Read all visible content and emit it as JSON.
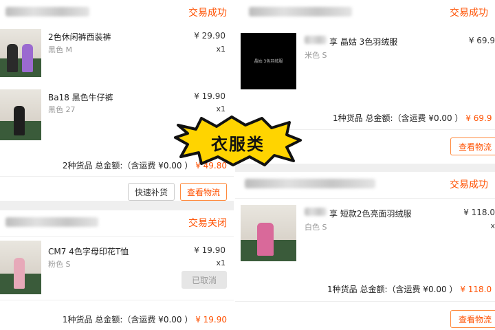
{
  "badge_text": "衣服类",
  "left": {
    "order1": {
      "status": "交易成功",
      "items": [
        {
          "title": "2色休闲裤西装裤",
          "sku": "黑色 M",
          "price": "¥ 29.90",
          "qty": "x1"
        },
        {
          "title": "Ba18 黑色牛仔裤",
          "sku": "黑色 27",
          "price": "¥ 19.90",
          "qty": "x1"
        }
      ],
      "summary": "2种货品 总金额:（含运费 ¥0.00 ）",
      "total": "¥ 49.80",
      "buttons": {
        "restock": "快速补货",
        "logistics": "查看物流"
      }
    },
    "order2": {
      "status": "交易关闭",
      "item": {
        "title": "CM7 4色字母印花T恤",
        "sku": "粉色 S",
        "price": "¥ 19.90",
        "qty": "x1"
      },
      "cancelled": "已取消",
      "summary": "1种货品 总金额:（含运费 ¥0.00 ）",
      "total": "¥ 19.90"
    }
  },
  "right": {
    "order1": {
      "status": "交易成功",
      "item": {
        "title": "享 晶姑 3色羽绒服",
        "thumb_text": "晶姑 3色羽绒服",
        "sku": "米色 S",
        "price": "¥ 69.9"
      },
      "summary": "1种货品 总金额:（含运费 ¥0.00 ）",
      "total": "¥ 69.9",
      "button": "查看物流"
    },
    "order2": {
      "status": "交易成功",
      "item": {
        "title": "享 短款2色亮面羽绒服",
        "sku": "白色 S",
        "price": "¥ 118.0",
        "qty": "x"
      },
      "summary": "1种货品 总金额:（含运费 ¥0.00 ）",
      "total": "¥ 118.0",
      "button": "查看物流"
    }
  },
  "colors": {
    "accent": "#ff5000",
    "badge_fill": "#ffd400"
  }
}
